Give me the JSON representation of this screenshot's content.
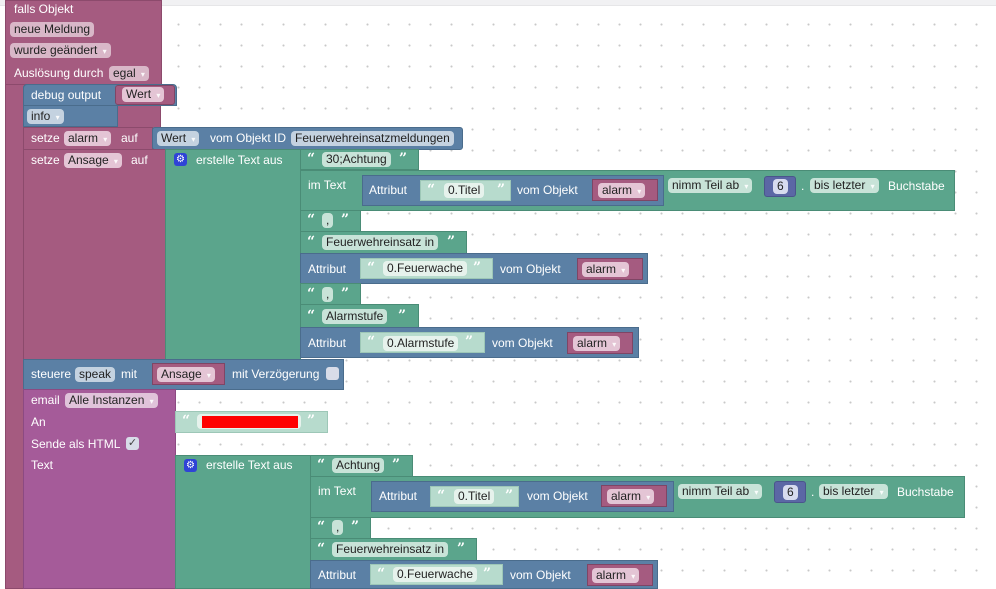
{
  "trigger": {
    "title": "falls Objekt",
    "object_name": "neue Meldung",
    "condition": "wurde geändert",
    "trigger_label": "Auslösung durch",
    "trigger_value": "egal"
  },
  "debug": {
    "label": "debug output",
    "value": "Wert",
    "level": "info"
  },
  "set_alarm": {
    "setze": "setze",
    "var": "alarm",
    "auf": "auf",
    "value_type": "Wert",
    "vom_objekt_id": "vom Objekt ID",
    "object_id": "Feuerwehreinsatzmeldungen"
  },
  "set_ansage": {
    "setze": "setze",
    "var": "Ansage",
    "auf": "auf",
    "join_label": "erstelle Text aus",
    "items": {
      "t1": "30;Achtung",
      "im_text": "im Text",
      "attr1": {
        "label": "Attribut",
        "key": "0.Titel",
        "vom": "vom Objekt",
        "var": "alarm"
      },
      "substring": {
        "mode": "nimm Teil ab",
        "num": "6",
        "dot": ".",
        "end": "bis letzter",
        "unit": "Buchstabe"
      },
      "t2": ",",
      "t3": "Feuerwehreinsatz in",
      "attr2": {
        "label": "Attribut",
        "key": "0.Feuerwache",
        "vom": "vom Objekt",
        "var": "alarm"
      },
      "t4": ",",
      "t5": "Alarmstufe",
      "attr3": {
        "label": "Attribut",
        "key": "0.Alarmstufe",
        "vom": "vom Objekt",
        "var": "alarm"
      }
    }
  },
  "speak": {
    "steuere": "steuere",
    "target": "speak",
    "mit": "mit",
    "var": "Ansage",
    "delay_label": "mit Verzögerung",
    "delay_checked": false
  },
  "email": {
    "label": "email",
    "instance": "Alle Instanzen",
    "an": "An",
    "html_label": "Sende als HTML",
    "html_checked": true,
    "check_glyph": "✓",
    "text_label": "Text",
    "join_label": "erstelle Text aus",
    "items": {
      "t1": "Achtung",
      "im_text": "im Text",
      "attr1": {
        "label": "Attribut",
        "key": "0.Titel",
        "vom": "vom Objekt",
        "var": "alarm"
      },
      "substring": {
        "mode": "nimm Teil ab",
        "num": "6",
        "dot": ".",
        "end": "bis letzter",
        "unit": "Buchstabe"
      },
      "t2": ",",
      "t3": "Feuerwehreinsatz in",
      "attr2": {
        "label": "Attribut",
        "key": "0.Feuerwache",
        "vom": "vom Objekt",
        "var": "alarm"
      }
    }
  },
  "glyphs": {
    "open_quote": "“",
    "close_quote": "”",
    "gear": "⚙"
  },
  "colors": {
    "trigger": "#a55b80",
    "debug": "#5b80a5",
    "text": "#5ba58c",
    "email": "#a55b99",
    "number": "#5b67a5",
    "redaction": "#ff0000"
  }
}
